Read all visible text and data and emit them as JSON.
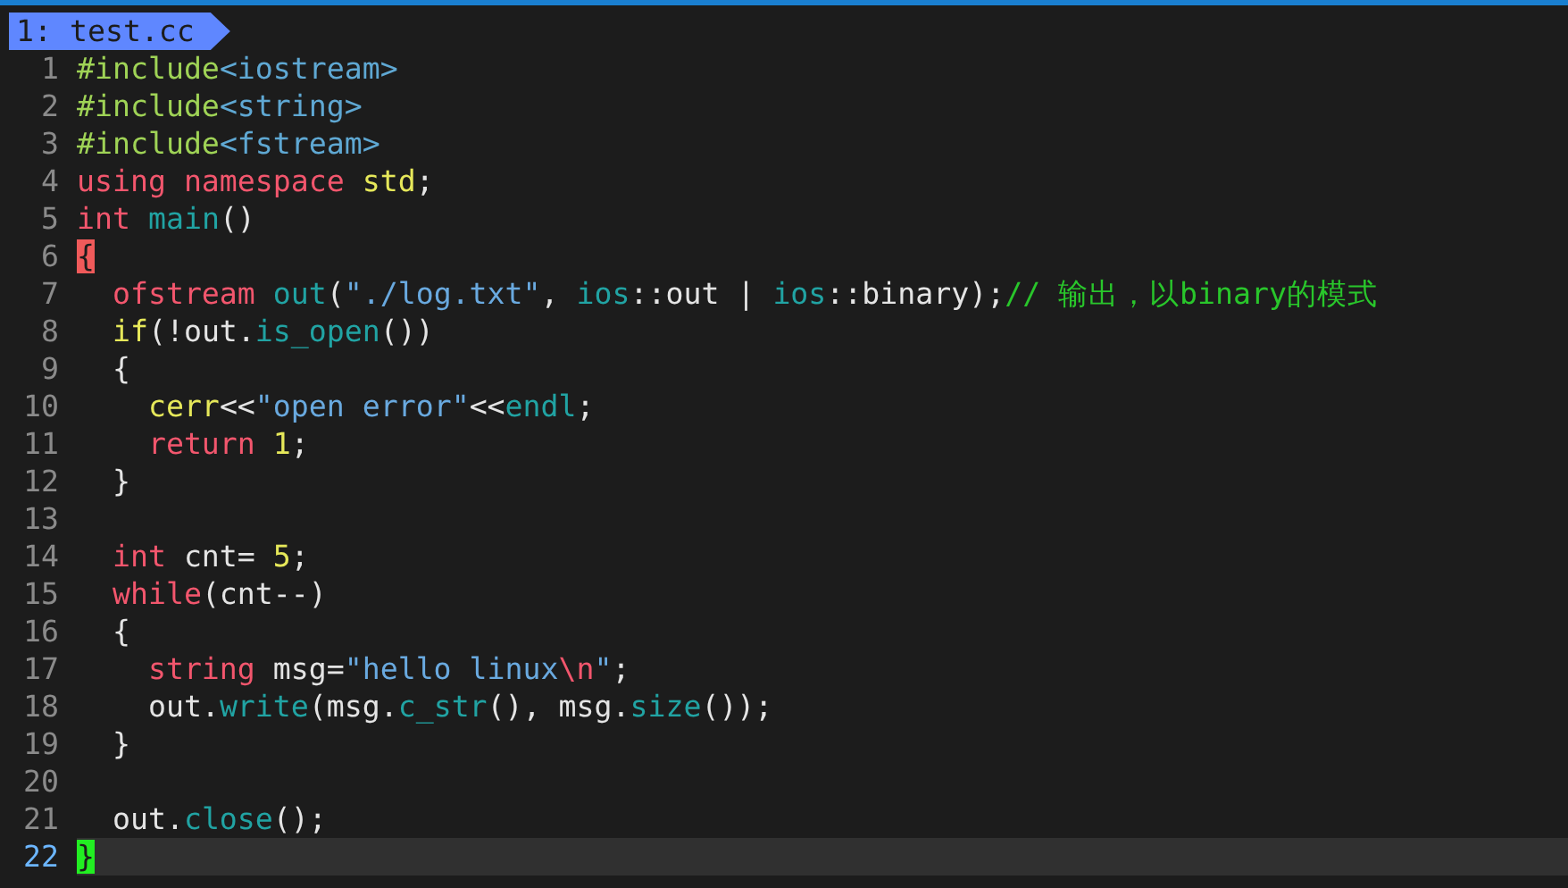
{
  "tabline": {
    "tabs": [
      {
        "label": "1: test.cc",
        "selected": true
      }
    ]
  },
  "lines": [
    {
      "number": "1",
      "current": false,
      "tokens": [
        {
          "kind": "preproc",
          "text": "#include"
        },
        {
          "kind": "header",
          "text": "<iostream>"
        }
      ]
    },
    {
      "number": "2",
      "current": false,
      "tokens": [
        {
          "kind": "preproc",
          "text": "#include"
        },
        {
          "kind": "header",
          "text": "<string>"
        }
      ]
    },
    {
      "number": "3",
      "current": false,
      "tokens": [
        {
          "kind": "preproc",
          "text": "#include"
        },
        {
          "kind": "header",
          "text": "<fstream>"
        }
      ]
    },
    {
      "number": "4",
      "current": false,
      "tokens": [
        {
          "kind": "keyword",
          "text": "using namespace"
        },
        {
          "kind": "builtin",
          "text": " std"
        },
        {
          "kind": "plain",
          "text": ";"
        }
      ]
    },
    {
      "number": "5",
      "current": false,
      "tokens": [
        {
          "kind": "keyword",
          "text": "int"
        },
        {
          "kind": "func",
          "text": " main"
        },
        {
          "kind": "plain",
          "text": "()"
        }
      ]
    },
    {
      "number": "6",
      "current": false,
      "tokens": [
        {
          "kind": "bracket_match",
          "text": "{"
        }
      ]
    },
    {
      "number": "7",
      "current": false,
      "tokens": [
        {
          "kind": "keyword",
          "text": "  ofstream"
        },
        {
          "kind": "func",
          "text": " out"
        },
        {
          "kind": "plain",
          "text": "("
        },
        {
          "kind": "string",
          "text": "\"./log.txt\""
        },
        {
          "kind": "plain",
          "text": ", "
        },
        {
          "kind": "func",
          "text": "ios"
        },
        {
          "kind": "plain",
          "text": "::out | "
        },
        {
          "kind": "func",
          "text": "ios"
        },
        {
          "kind": "plain",
          "text": "::binary);"
        },
        {
          "kind": "comment",
          "text": "// 输出，以binary的模式"
        }
      ]
    },
    {
      "number": "8",
      "current": false,
      "tokens": [
        {
          "kind": "builtin",
          "text": "  if"
        },
        {
          "kind": "plain",
          "text": "(!out."
        },
        {
          "kind": "func",
          "text": "is_open"
        },
        {
          "kind": "plain",
          "text": "())"
        }
      ]
    },
    {
      "number": "9",
      "current": false,
      "tokens": [
        {
          "kind": "plain",
          "text": "  {"
        }
      ]
    },
    {
      "number": "10",
      "current": false,
      "tokens": [
        {
          "kind": "builtin",
          "text": "    cerr"
        },
        {
          "kind": "plain",
          "text": "<<"
        },
        {
          "kind": "string",
          "text": "\"open error\""
        },
        {
          "kind": "plain",
          "text": "<<"
        },
        {
          "kind": "func",
          "text": "endl"
        },
        {
          "kind": "plain",
          "text": ";"
        }
      ]
    },
    {
      "number": "11",
      "current": false,
      "tokens": [
        {
          "kind": "keyword",
          "text": "    return"
        },
        {
          "kind": "builtin",
          "text": " 1"
        },
        {
          "kind": "plain",
          "text": ";"
        }
      ]
    },
    {
      "number": "12",
      "current": false,
      "tokens": [
        {
          "kind": "plain",
          "text": "  }"
        }
      ]
    },
    {
      "number": "13",
      "current": false
    },
    {
      "number": "14",
      "current": false,
      "tokens": [
        {
          "kind": "keyword",
          "text": "  int"
        },
        {
          "kind": "plain",
          "text": " cnt="
        },
        {
          "kind": "builtin",
          "text": " 5"
        },
        {
          "kind": "plain",
          "text": ";"
        }
      ]
    },
    {
      "number": "15",
      "current": false,
      "tokens": [
        {
          "kind": "keyword",
          "text": "  while"
        },
        {
          "kind": "plain",
          "text": "(cnt--)"
        }
      ]
    },
    {
      "number": "16",
      "current": false,
      "tokens": [
        {
          "kind": "plain",
          "text": "  {"
        }
      ]
    },
    {
      "number": "17",
      "current": false,
      "tokens": [
        {
          "kind": "keyword",
          "text": "    string"
        },
        {
          "kind": "plain",
          "text": " msg="
        },
        {
          "kind": "string",
          "text": "\"hello linux"
        },
        {
          "kind": "escape",
          "text": "\\n"
        },
        {
          "kind": "string",
          "text": "\""
        },
        {
          "kind": "plain",
          "text": ";"
        }
      ]
    },
    {
      "number": "18",
      "current": false,
      "tokens": [
        {
          "kind": "plain",
          "text": "    out."
        },
        {
          "kind": "func",
          "text": "write"
        },
        {
          "kind": "plain",
          "text": "(msg."
        },
        {
          "kind": "func",
          "text": "c_str"
        },
        {
          "kind": "plain",
          "text": "(), msg."
        },
        {
          "kind": "func",
          "text": "size"
        },
        {
          "kind": "plain",
          "text": "());"
        }
      ]
    },
    {
      "number": "19",
      "current": false,
      "tokens": [
        {
          "kind": "plain",
          "text": "  }"
        }
      ]
    },
    {
      "number": "20",
      "current": false
    },
    {
      "number": "21",
      "current": false,
      "tokens": [
        {
          "kind": "plain",
          "text": "  out."
        },
        {
          "kind": "func",
          "text": "close"
        },
        {
          "kind": "plain",
          "text": "();"
        }
      ]
    },
    {
      "number": "22",
      "current": true,
      "tokens": [
        {
          "kind": "bracket_cursor",
          "text": "}"
        }
      ]
    }
  ]
}
